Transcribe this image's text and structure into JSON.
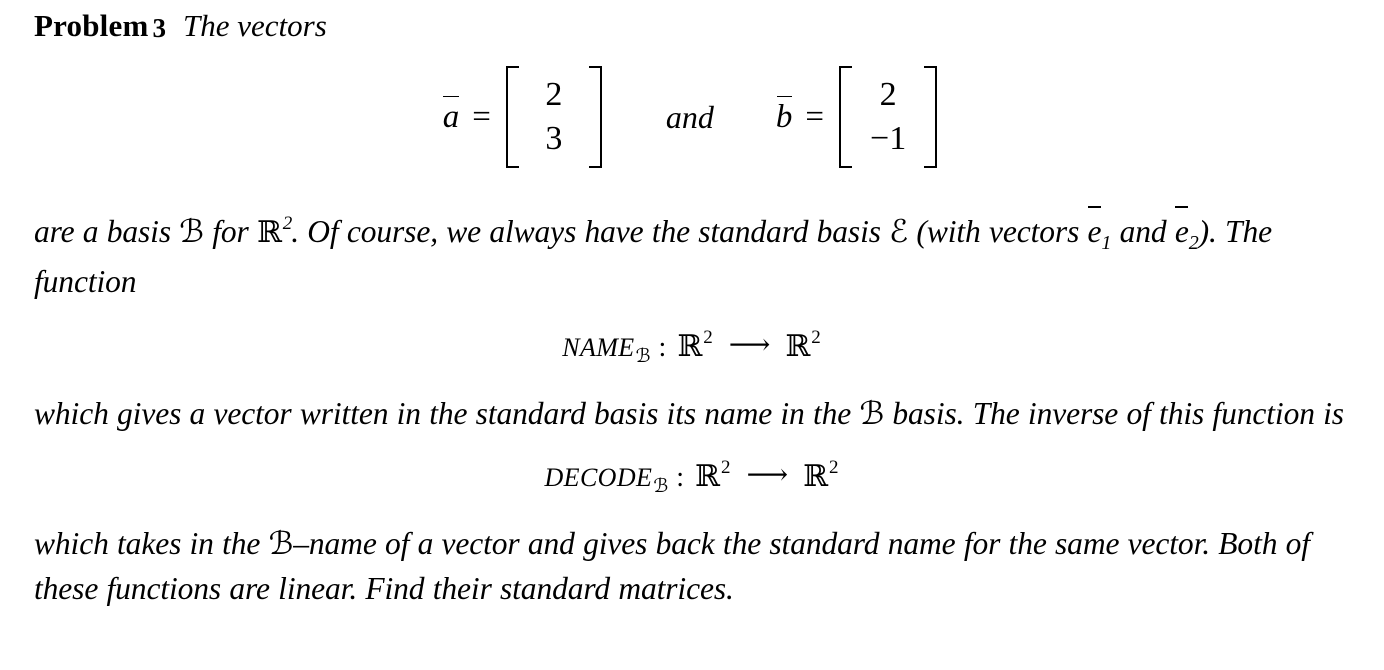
{
  "document": {
    "type": "math-textbook-problem",
    "background_color": "#ffffff",
    "text_color": "#000000"
  },
  "heading": {
    "label": "Problem",
    "number": "3",
    "text": "The vectors"
  },
  "vectors": {
    "a": {
      "name": "a",
      "overbar": true,
      "equals": "=",
      "entries": [
        "2",
        "3"
      ]
    },
    "conjunction": "and",
    "b": {
      "name": "b",
      "overbar": true,
      "equals": "=",
      "entries": [
        "2",
        "−1"
      ]
    }
  },
  "paragraph_1": {
    "line_1": "are a basis ℬ for ℝ². Of course, we always have the standard basis ℰ (with vectors ē₁",
    "line_2": "and ē₂). The function",
    "full_text": "are a basis ℬ for ℝ². Of course, we always have the standard basis ℰ (with vectors ē1 and ē2). The function",
    "segments": {
      "s1": "are a basis ",
      "basis_symbol": "ℬ",
      "s2": " for ",
      "reals": "ℝ",
      "exponent": "2",
      "s3": ". Of course, we always have the standard basis ",
      "standard_basis_symbol": "ℰ",
      "s4": " (with vectors ",
      "e1_name": "e",
      "e1_sub": "1",
      "s5": " and ",
      "e2_name": "e",
      "e2_sub": "2",
      "s6": "). The function"
    }
  },
  "function_name": {
    "label": "NAME",
    "subscript": "ℬ",
    "colon": ":",
    "domain": "ℝ",
    "domain_exp": "2",
    "arrow": "⟶",
    "codomain": "ℝ",
    "codomain_exp": "2",
    "full_text": "NAMEℬ : ℝ² ⟶ ℝ²"
  },
  "paragraph_2": {
    "segments": {
      "s1": "which gives a vector written in the standard basis its name in the ",
      "basis_symbol": "ℬ",
      "s2": " basis. The inverse of this function is"
    },
    "full_text": "which gives a vector written in the standard basis its name in the ℬ basis. The inverse of this function is"
  },
  "function_decode": {
    "label": "DECODE",
    "subscript": "ℬ",
    "colon": ":",
    "domain": "ℝ",
    "domain_exp": "2",
    "arrow": "⟶",
    "codomain": "ℝ",
    "codomain_exp": "2",
    "full_text": "DECODEℬ : ℝ² ⟶ ℝ²"
  },
  "paragraph_3": {
    "segments": {
      "s1": "which takes in the ",
      "basis_symbol": "ℬ",
      "s2": "–name of a vector and gives back the standard name for the same vector. Both of these functions are linear. Find their standard matrices."
    },
    "full_text": "which takes in the ℬ–name of a vector and gives back the standard name for the same vector. Both of these functions are linear. Find their standard matrices."
  }
}
